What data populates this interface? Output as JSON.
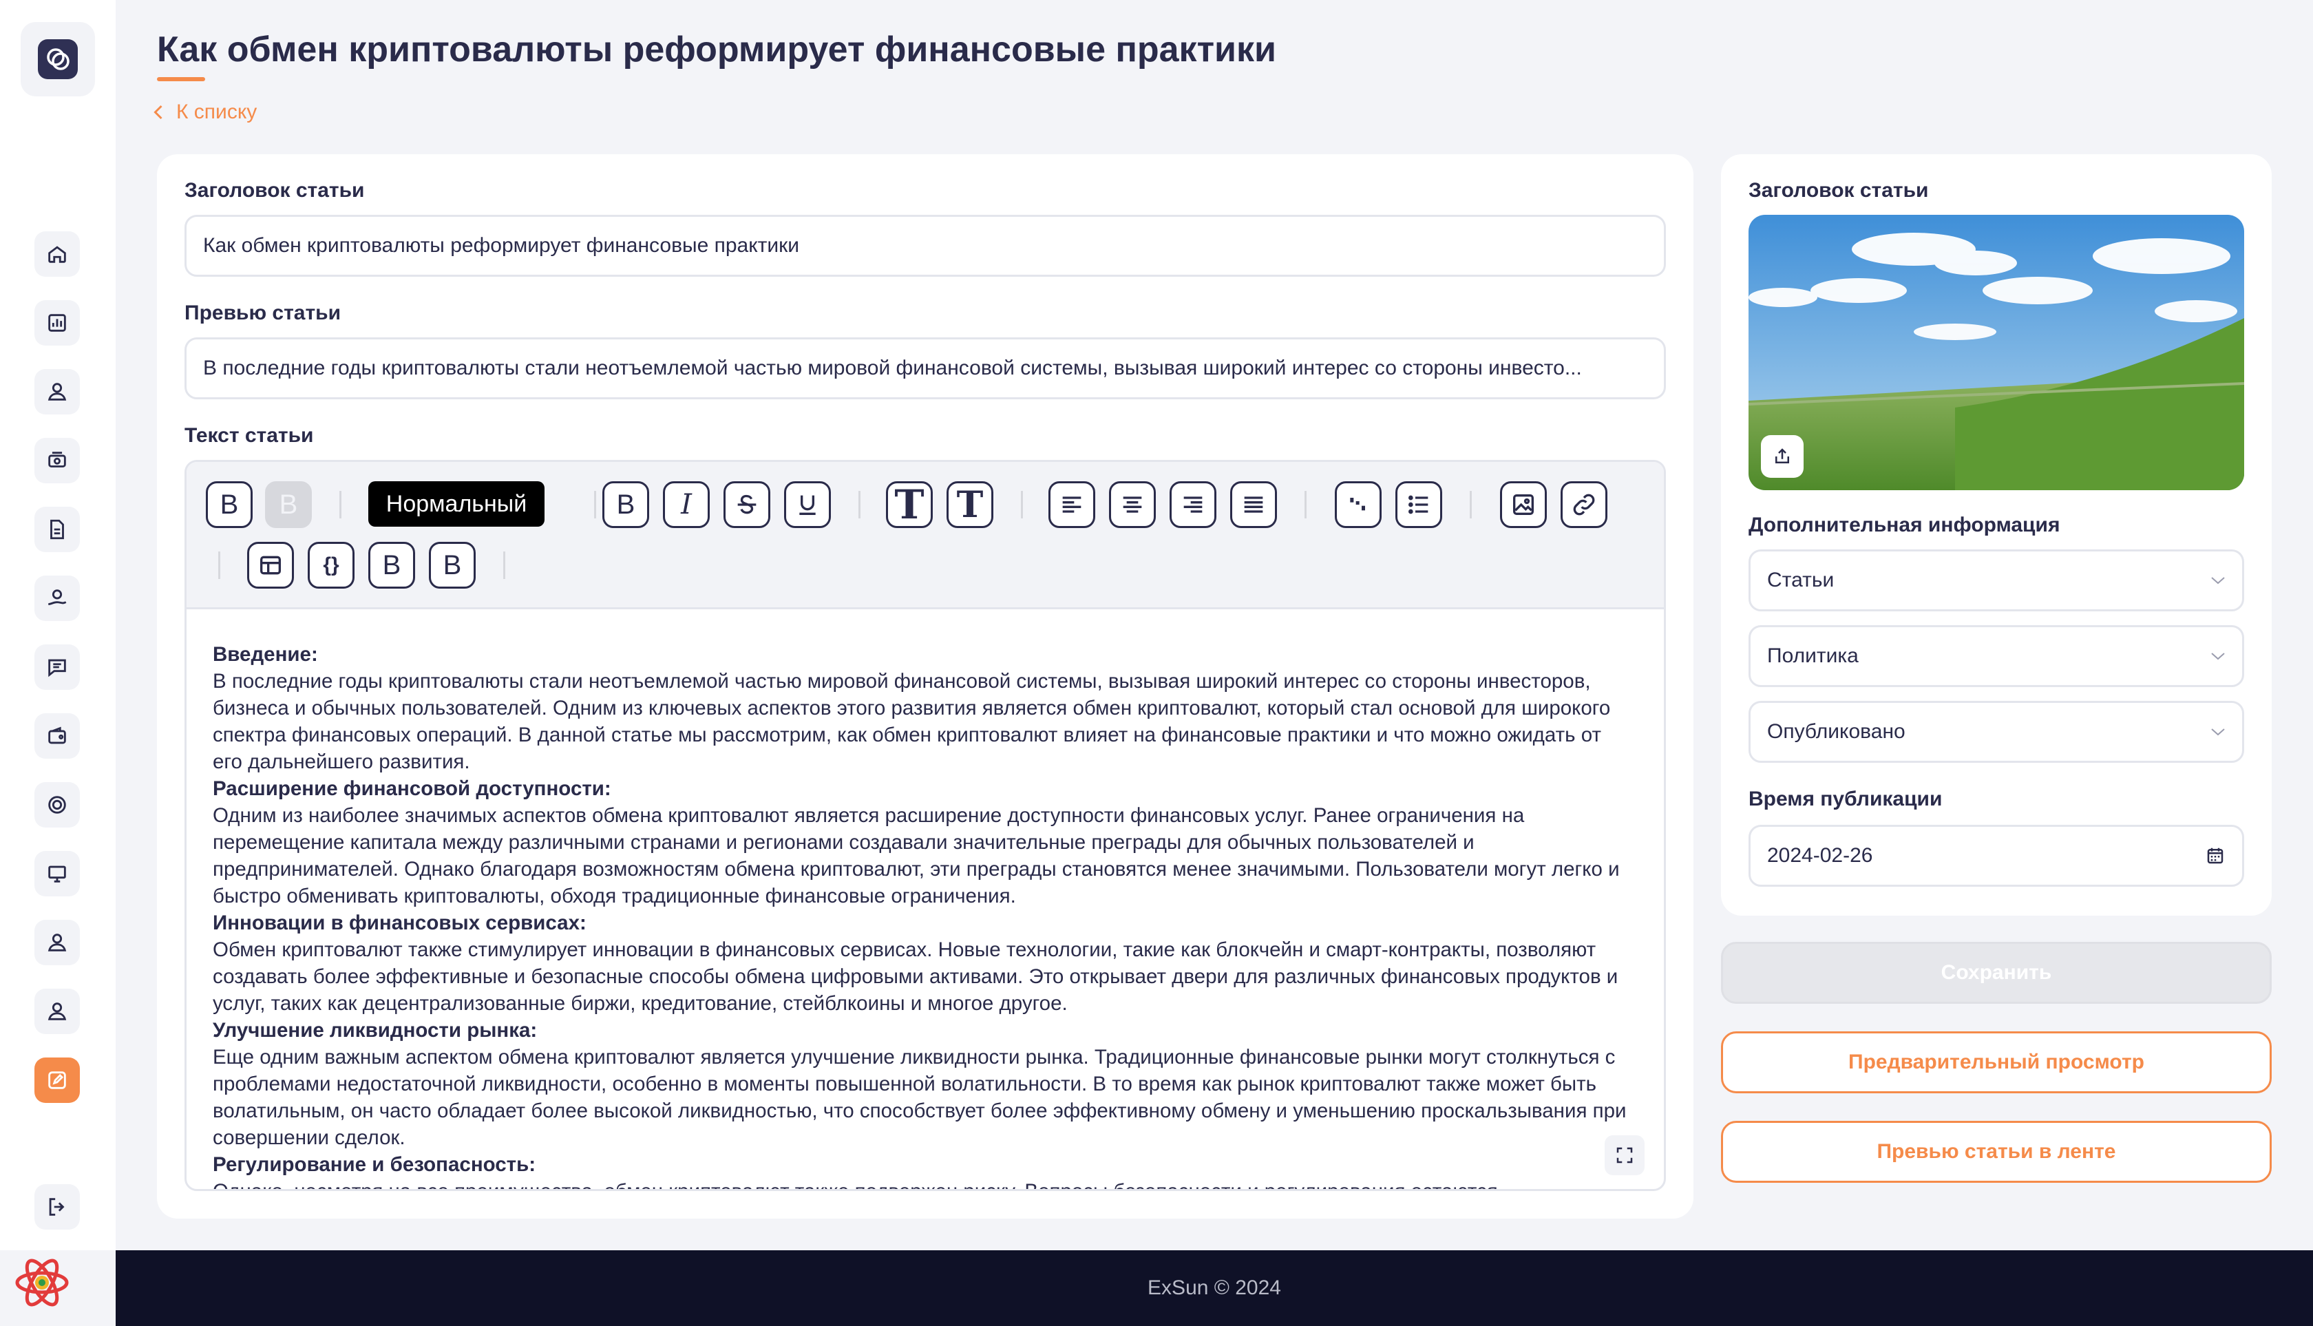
{
  "page": {
    "title": "Как обмен криптовалюты реформирует финансовые практики",
    "back_label": "К списку"
  },
  "form": {
    "title_label": "Заголовок статьи",
    "title_value": "Как обмен криптовалюты реформирует финансовые практики",
    "preview_label": "Превью статьи",
    "preview_value": "В последние годы криптовалюты стали неотъемлемой частью мировой финансовой системы, вызывая широкий интерес со стороны инвесто...",
    "text_label": "Текст статьи"
  },
  "toolbar": {
    "block_type": "Нормальный",
    "bold_letter": "B",
    "italic_letter": "I",
    "big_t": "T",
    "code_label": "{}"
  },
  "article": [
    {
      "heading": "Введение:",
      "text": "В последние годы криптовалюты стали неотъемлемой частью мировой финансовой системы, вызывая широкий интерес со стороны инвесторов, бизнеса и обычных пользователей. Одним из ключевых аспектов этого развития является обмен криптовалют, который стал основой для широкого спектра финансовых операций. В данной статье мы рассмотрим, как обмен криптовалют влияет на финансовые практики и что можно ожидать от его дальнейшего развития."
    },
    {
      "heading": "Расширение финансовой доступности:",
      "text": "Одним из наиболее значимых аспектов обмена криптовалют является расширение доступности финансовых услуг. Ранее ограничения на перемещение капитала между различными странами и регионами создавали значительные преграды для обычных пользователей и предпринимателей. Однако благодаря возможностям обмена криптовалют, эти преграды становятся менее значимыми. Пользователи могут легко и быстро обменивать криптовалюты, обходя традиционные финансовые ограничения."
    },
    {
      "heading": "Инновации в финансовых сервисах:",
      "text": "Обмен криптовалют также стимулирует инновации в финансовых сервисах. Новые технологии, такие как блокчейн и смарт-контракты, позволяют создавать более эффективные и безопасные способы обмена цифровыми активами. Это открывает двери для различных финансовых продуктов и услуг, таких как децентрализованные биржи, кредитование, стейблкоины и многое другое."
    },
    {
      "heading": "Улучшение ликвидности рынка:",
      "text": "Еще одним важным аспектом обмена криптовалют является улучшение ликвидности рынка. Традиционные финансовые рынки могут столкнуться с проблемами недостаточной ликвидности, особенно в моменты повышенной волатильности. В то время как рынок криптовалют также может быть волатильным, он часто обладает более высокой ликвидностью, что способствует более эффективному обмену и уменьшению проскальзывания при совершении сделок."
    },
    {
      "heading": "Регулирование и безопасность:",
      "text": "Однако, несмотря на все преимущества, обмен криптовалют также подвержен риску. Вопросы безопасности и регулирования остаются"
    }
  ],
  "side": {
    "cover_label": "Заголовок статьи",
    "extra_label": "Дополнительная информация",
    "category": "Статьи",
    "tag": "Политика",
    "status": "Опубликовано",
    "publish_label": "Время публикации",
    "publish_date": "2024-02-26"
  },
  "buttons": {
    "save": "Сохранить",
    "preview": "Предварительный просмотр",
    "feed_preview": "Превью статьи в ленте"
  },
  "footer": {
    "text": "ExSun © 2024"
  },
  "colors": {
    "accent": "#f58b4a",
    "dark": "#2a2b4a",
    "footer_bg": "#0f1127"
  }
}
